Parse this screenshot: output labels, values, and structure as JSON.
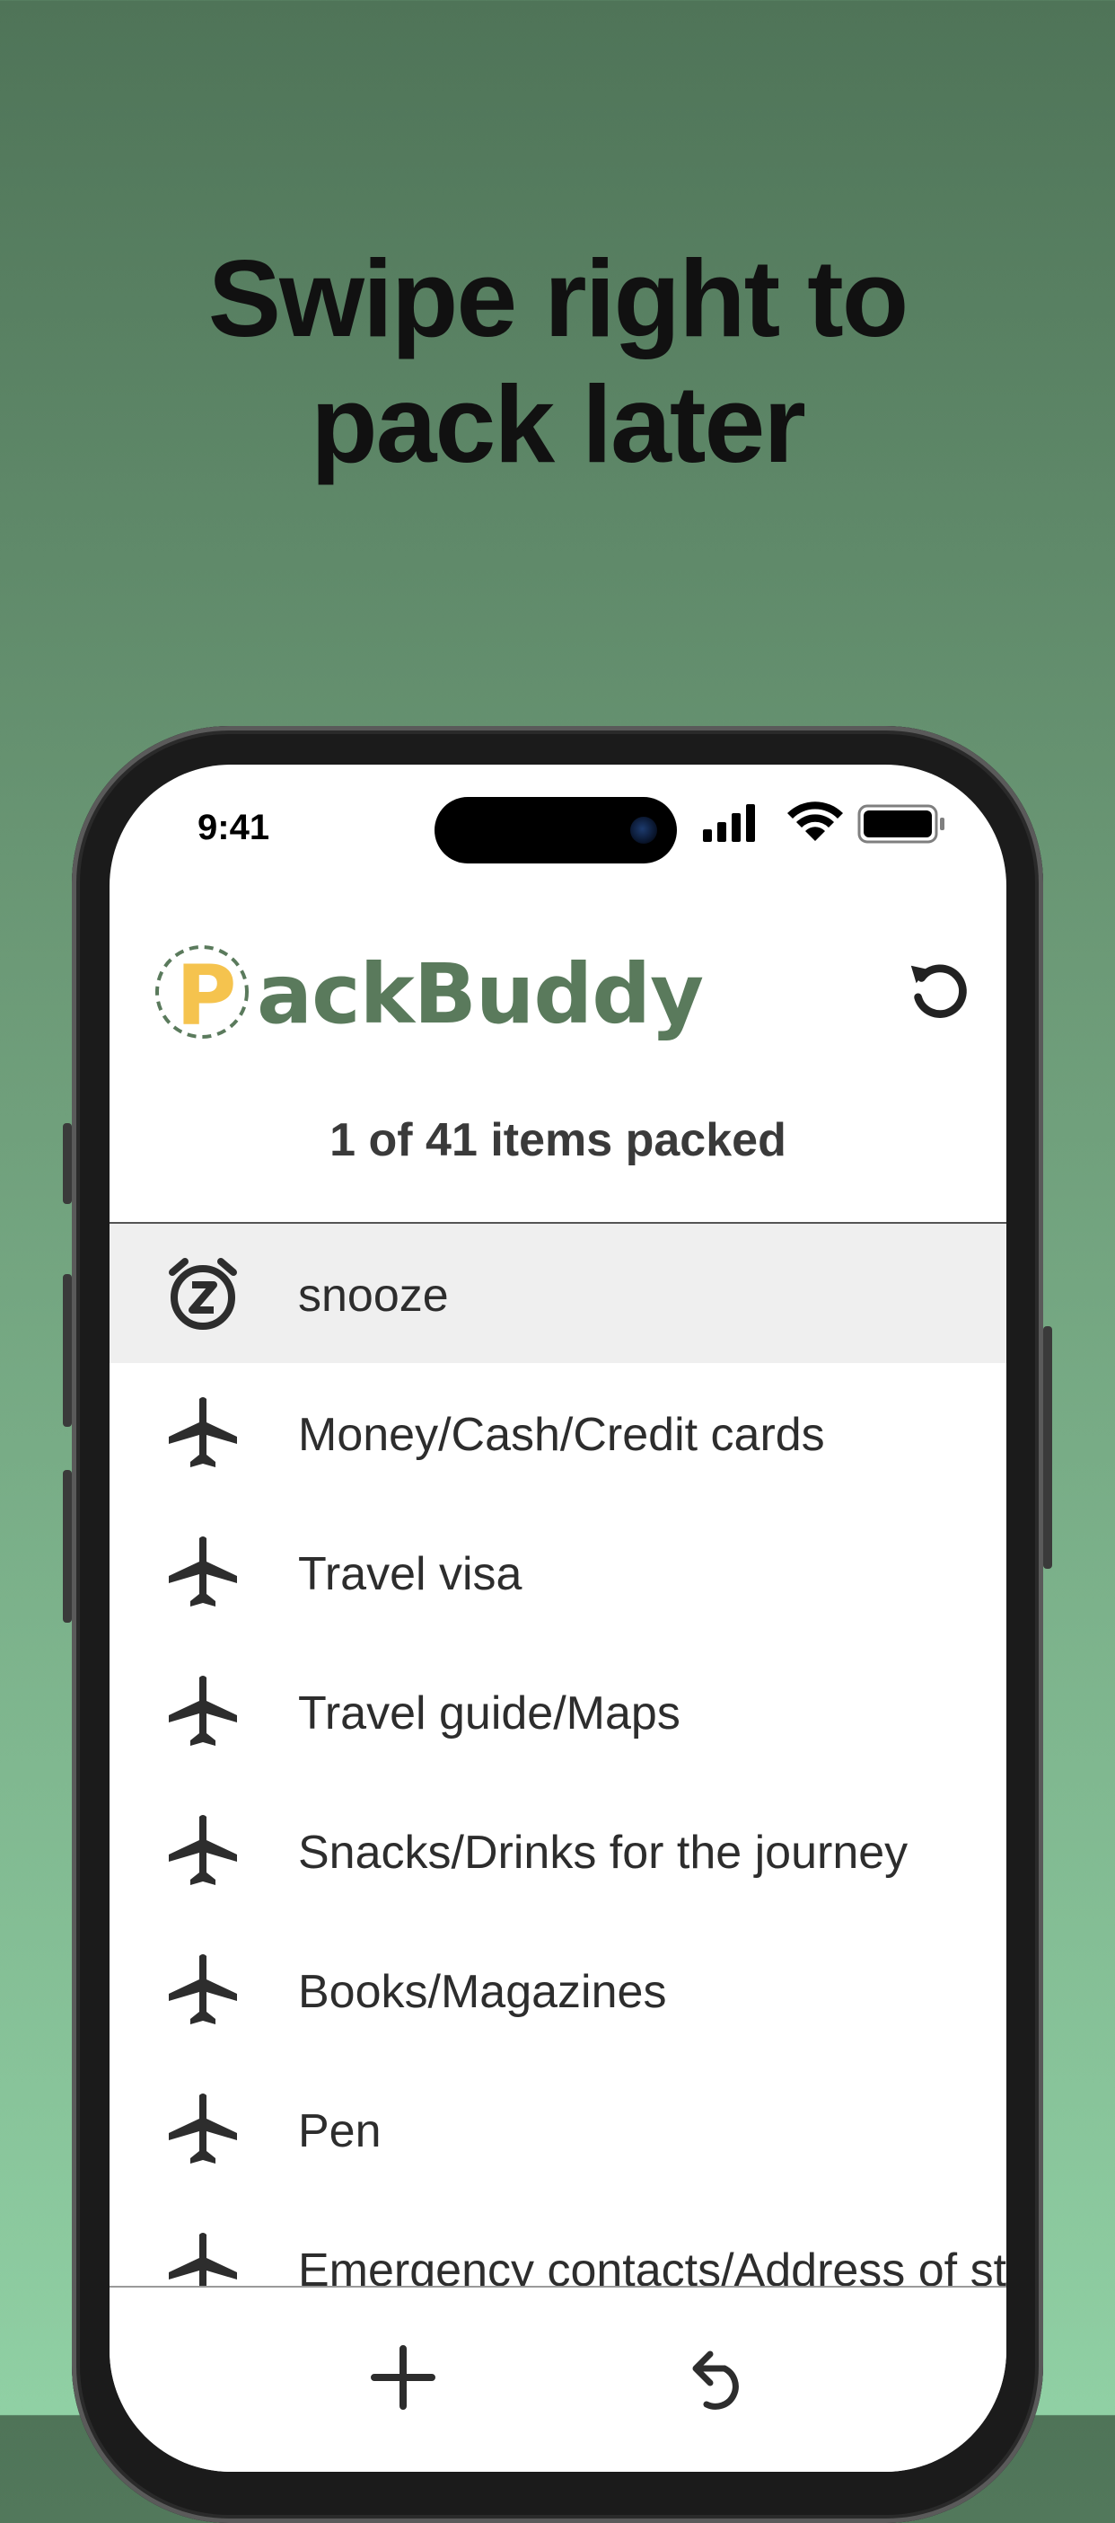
{
  "headline": {
    "line1": "Swipe right to",
    "line2": "pack later"
  },
  "status_bar": {
    "time": "9:41"
  },
  "app": {
    "logo_text": "ackBuddy",
    "logo_letter": "P",
    "packed_summary": "1 of 41 items packed"
  },
  "items": [
    {
      "label": "snooze",
      "icon": "alarm-snooze-icon",
      "state": "snoozed"
    },
    {
      "label": "Money/Cash/Credit cards",
      "icon": "airplane-icon"
    },
    {
      "label": "Travel visa",
      "icon": "airplane-icon"
    },
    {
      "label": "Travel guide/Maps",
      "icon": "airplane-icon"
    },
    {
      "label": "Snacks/Drinks for the journey",
      "icon": "airplane-icon"
    },
    {
      "label": "Books/Magazines",
      "icon": "airplane-icon"
    },
    {
      "label": "Pen",
      "icon": "airplane-icon"
    },
    {
      "label": "Emergency contacts/Address of st",
      "icon": "airplane-icon"
    }
  ],
  "toolbar": {
    "add_icon": "plus-icon",
    "undo_icon": "undo-icon"
  },
  "colors": {
    "background_top": "#4f7458",
    "background_bottom": "#90d0a4",
    "brand_green": "#5a7a5c",
    "brand_yellow": "#f5c34e",
    "snoozed_row": "#efefef"
  }
}
